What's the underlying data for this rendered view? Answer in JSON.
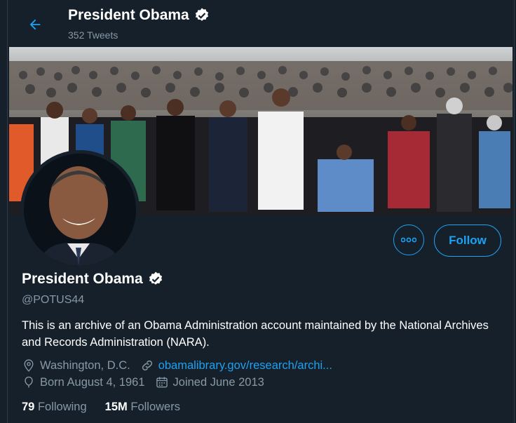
{
  "header": {
    "name": "President Obama",
    "tweet_count": "352 Tweets"
  },
  "profile": {
    "name": "President Obama",
    "handle": "@POTUS44",
    "bio": "This is an archive of an Obama Administration account maintained by the National Archives and Records Administration (NARA).",
    "location": "Washington, D.C.",
    "website": "obamalibrary.gov/research/archi...",
    "birthday": "Born August 4, 1961",
    "joined": "Joined June 2013"
  },
  "actions": {
    "more_icon": "more-dots-icon",
    "follow_label": "Follow"
  },
  "stats": {
    "following_count": "79",
    "following_label": "Following",
    "followers_count": "15M",
    "followers_label": "Followers"
  },
  "colors": {
    "background": "#15202b",
    "accent": "#1da1f2",
    "secondary_text": "#8899a6"
  }
}
